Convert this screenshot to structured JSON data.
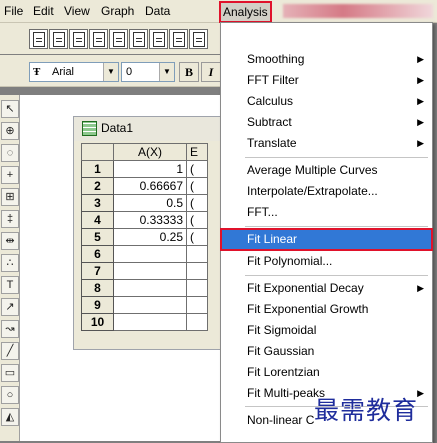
{
  "menubar": {
    "items": [
      "File",
      "Edit",
      "View",
      "Graph",
      "Data"
    ],
    "active": "Analysis"
  },
  "toolbar": {
    "font_name": "Arial",
    "font_size": "0",
    "bold": "B",
    "italic": "I"
  },
  "worksheet": {
    "title": "Data1",
    "columns": [
      "A(X)",
      "E"
    ],
    "rows": [
      "1",
      "2",
      "3",
      "4",
      "5",
      "6",
      "7",
      "8",
      "9",
      "10"
    ],
    "values": [
      "1",
      "0.66667",
      "0.5",
      "0.33333",
      "0.25",
      "",
      "",
      "",
      "",
      ""
    ]
  },
  "analysis_menu": {
    "items": [
      {
        "label": "Smoothing",
        "submenu": true
      },
      {
        "label": "FFT Filter",
        "submenu": true
      },
      {
        "label": "Calculus",
        "submenu": true
      },
      {
        "label": "Subtract",
        "submenu": true
      },
      {
        "label": "Translate",
        "submenu": true
      },
      {
        "label": "Average Multiple Curves",
        "submenu": false
      },
      {
        "label": "Interpolate/Extrapolate...",
        "submenu": false
      },
      {
        "label": "FFT...",
        "submenu": false
      },
      {
        "label": "Fit Linear",
        "submenu": false,
        "highlighted": true
      },
      {
        "label": "Fit Polynomial...",
        "submenu": false
      },
      {
        "label": "Fit Exponential Decay",
        "submenu": true
      },
      {
        "label": "Fit Exponential Growth",
        "submenu": false
      },
      {
        "label": "Fit Sigmoidal",
        "submenu": false
      },
      {
        "label": "Fit Gaussian",
        "submenu": false
      },
      {
        "label": "Fit Lorentzian",
        "submenu": false
      },
      {
        "label": "Fit Multi-peaks",
        "submenu": true
      },
      {
        "label": "Non-linear C",
        "submenu": false
      }
    ]
  },
  "watermark": "最需教育",
  "colors": {
    "highlight": "#3178d6",
    "annotation": "#e0122b"
  }
}
